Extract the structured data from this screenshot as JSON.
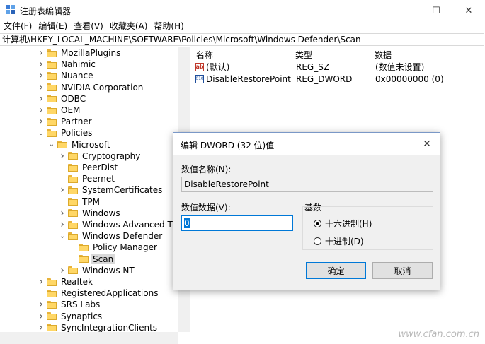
{
  "window": {
    "title": "注册表编辑器",
    "minimize": "—",
    "maximize": "☐",
    "close": "✕"
  },
  "menu": [
    "文件(F)",
    "编辑(E)",
    "查看(V)",
    "收藏夹(A)",
    "帮助(H)"
  ],
  "address": "计算机\\HKEY_LOCAL_MACHINE\\SOFTWARE\\Policies\\Microsoft\\Windows Defender\\Scan",
  "tree": [
    {
      "label": "MozillaPlugins",
      "level": 0,
      "expander": ">"
    },
    {
      "label": "Nahimic",
      "level": 0,
      "expander": ">"
    },
    {
      "label": "Nuance",
      "level": 0,
      "expander": ">"
    },
    {
      "label": "NVIDIA Corporation",
      "level": 0,
      "expander": ">"
    },
    {
      "label": "ODBC",
      "level": 0,
      "expander": ">"
    },
    {
      "label": "OEM",
      "level": 0,
      "expander": ">"
    },
    {
      "label": "Partner",
      "level": 0,
      "expander": ">"
    },
    {
      "label": "Policies",
      "level": 0,
      "expander": "v"
    },
    {
      "label": "Microsoft",
      "level": 1,
      "expander": "v"
    },
    {
      "label": "Cryptography",
      "level": 2,
      "expander": ">"
    },
    {
      "label": "PeerDist",
      "level": 2,
      "expander": ""
    },
    {
      "label": "Peernet",
      "level": 2,
      "expander": ""
    },
    {
      "label": "SystemCertificates",
      "level": 2,
      "expander": ">"
    },
    {
      "label": "TPM",
      "level": 2,
      "expander": ""
    },
    {
      "label": "Windows",
      "level": 2,
      "expander": ">"
    },
    {
      "label": "Windows Advanced Threat Protection",
      "level": 2,
      "expander": ">"
    },
    {
      "label": "Windows Defender",
      "level": 2,
      "expander": "v"
    },
    {
      "label": "Policy Manager",
      "level": 3,
      "expander": ""
    },
    {
      "label": "Scan",
      "level": 3,
      "expander": "",
      "selected": true
    },
    {
      "label": "Windows NT",
      "level": 2,
      "expander": ">"
    },
    {
      "label": "Realtek",
      "level": 0,
      "expander": ">"
    },
    {
      "label": "RegisteredApplications",
      "level": 0,
      "expander": ""
    },
    {
      "label": "SRS Labs",
      "level": 0,
      "expander": ">"
    },
    {
      "label": "Synaptics",
      "level": 0,
      "expander": ">"
    },
    {
      "label": "SyncIntegrationClients",
      "level": 0,
      "expander": ">"
    }
  ],
  "values_pane": {
    "columns": [
      "名称",
      "类型",
      "数据"
    ],
    "rows": [
      {
        "name": "(默认)",
        "type": "REG_SZ",
        "data": "(数值未设置)",
        "icon": "ab-string-icon"
      },
      {
        "name": "DisableRestorePoint",
        "type": "REG_DWORD",
        "data": "0x00000000 (0)",
        "icon": "binary-dword-icon"
      }
    ]
  },
  "dialog": {
    "title": "编辑 DWORD (32 位)值",
    "name_label": "数值名称(N):",
    "name_value": "DisableRestorePoint",
    "data_label": "数值数据(V):",
    "data_value": "0",
    "base_label": "基数",
    "hex_label": "十六进制(H)",
    "dec_label": "十进制(D)",
    "selected_base": "hex",
    "ok": "确定",
    "cancel": "取消"
  },
  "watermark": "www.cfan.com.cn"
}
